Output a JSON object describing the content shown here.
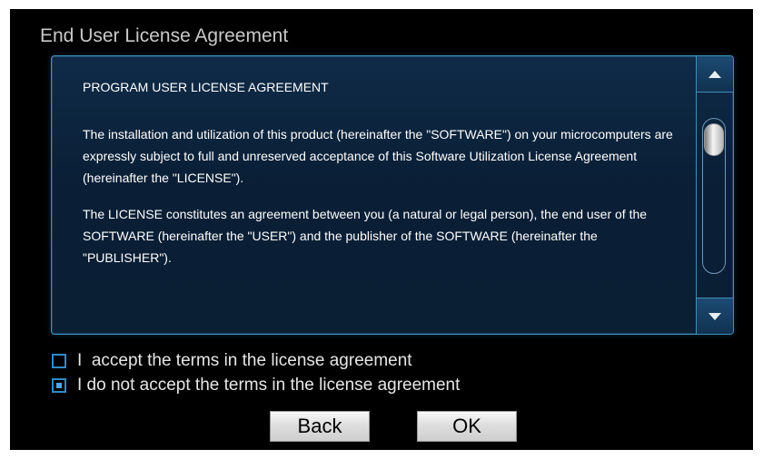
{
  "dialog": {
    "title": "End User License Agreement"
  },
  "license": {
    "heading": "PROGRAM USER LICENSE AGREEMENT",
    "paragraphs": [
      "The installation and utilization of this product (hereinafter the \"SOFTWARE\") on your microcomputers are expressly subject to full and unreserved acceptance of this Software Utilization License Agreement (hereinafter the \"LICENSE\").",
      "The LICENSE constitutes an agreement between you (a natural or legal person), the end user of the SOFTWARE (hereinafter the \"USER\") and the publisher of the SOFTWARE (hereinafter the \"PUBLISHER\")."
    ]
  },
  "options": {
    "accept_label": "I  accept the terms in the license agreement",
    "decline_label": "I do not accept the terms in the license agreement",
    "selected": "decline"
  },
  "buttons": {
    "back_label": "Back",
    "ok_label": "OK"
  },
  "icons": {
    "scroll_up": "triangle-up-icon",
    "scroll_down": "triangle-down-icon"
  },
  "colors": {
    "panel_border": "#3f8fb8",
    "checkbox_accent": "#2f8ac8",
    "background": "#000000"
  }
}
